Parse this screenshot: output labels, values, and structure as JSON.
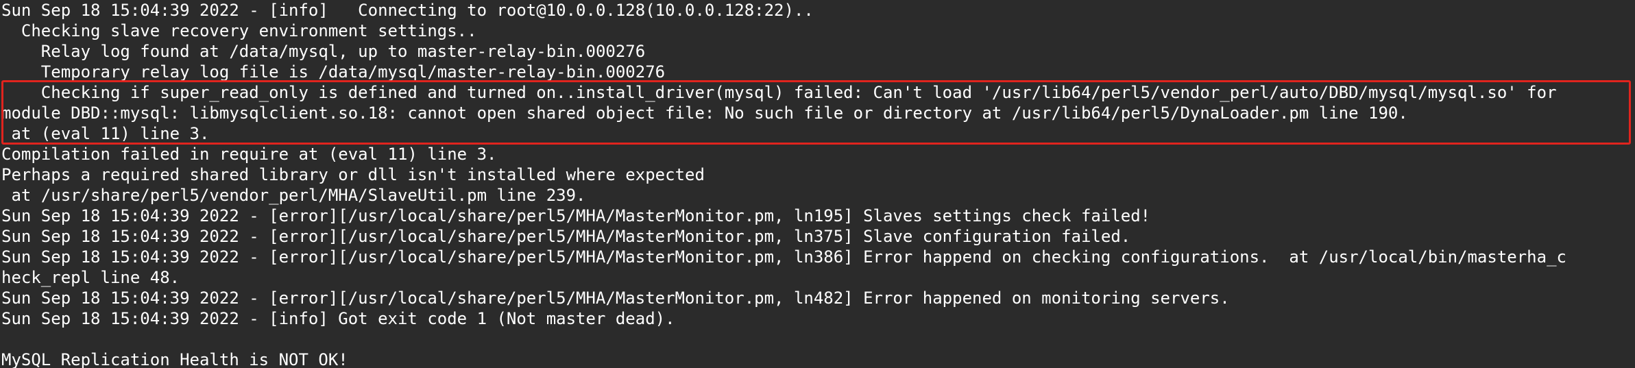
{
  "terminal": {
    "lines": [
      "Sun Sep 18 15:04:39 2022 - [info]   Connecting to root@10.0.0.128(10.0.0.128:22)..",
      "  Checking slave recovery environment settings..",
      "    Relay log found at /data/mysql, up to master-relay-bin.000276",
      "    Temporary relay log file is /data/mysql/master-relay-bin.000276",
      "    Checking if super_read_only is defined and turned on..install_driver(mysql) failed: Can't load '/usr/lib64/perl5/vendor_perl/auto/DBD/mysql/mysql.so' for",
      "module DBD::mysql: libmysqlclient.so.18: cannot open shared object file: No such file or directory at /usr/lib64/perl5/DynaLoader.pm line 190.",
      " at (eval 11) line 3.",
      "Compilation failed in require at (eval 11) line 3.",
      "Perhaps a required shared library or dll isn't installed where expected",
      " at /usr/share/perl5/vendor_perl/MHA/SlaveUtil.pm line 239.",
      "Sun Sep 18 15:04:39 2022 - [error][/usr/local/share/perl5/MHA/MasterMonitor.pm, ln195] Slaves settings check failed!",
      "Sun Sep 18 15:04:39 2022 - [error][/usr/local/share/perl5/MHA/MasterMonitor.pm, ln375] Slave configuration failed.",
      "Sun Sep 18 15:04:39 2022 - [error][/usr/local/share/perl5/MHA/MasterMonitor.pm, ln386] Error happend on checking configurations.  at /usr/local/bin/masterha_c",
      "heck_repl line 48.",
      "Sun Sep 18 15:04:39 2022 - [error][/usr/local/share/perl5/MHA/MasterMonitor.pm, ln482] Error happened on monitoring servers.",
      "Sun Sep 18 15:04:39 2022 - [info] Got exit code 1 (Not master dead).",
      "",
      "MySQL Replication Health is NOT OK!"
    ]
  },
  "colors": {
    "background": "#2b2b2b",
    "text": "#ffffff",
    "highlight_border": "#e0241e"
  }
}
